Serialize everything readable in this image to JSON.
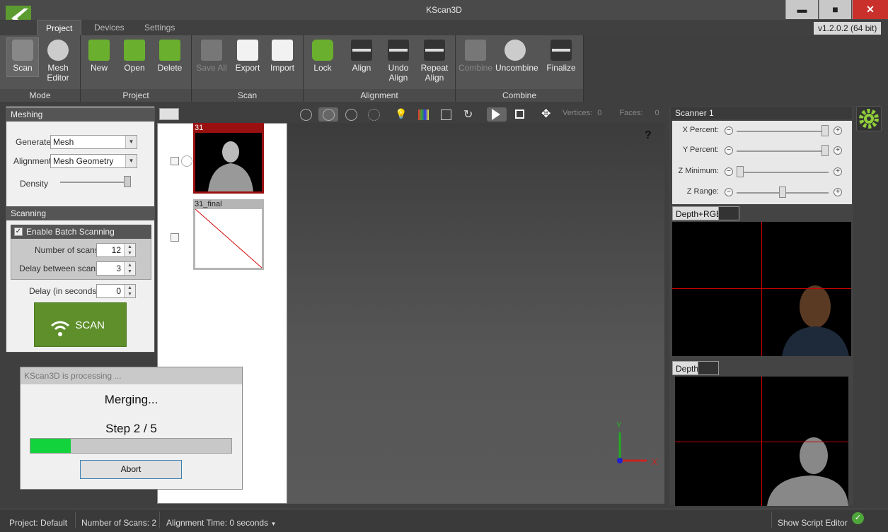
{
  "app": {
    "title": "KScan3D",
    "version": "v1.2.0.2  (64 bit)"
  },
  "window": {
    "minimize": "▬",
    "maximize": "■",
    "close": "✕"
  },
  "tabs": [
    "Project",
    "Devices",
    "Settings"
  ],
  "ribbon": {
    "mode": {
      "label": "Mode",
      "scan": "Scan",
      "mesh_editor": "Mesh Editor"
    },
    "project": {
      "label": "Project",
      "new": "New",
      "open": "Open",
      "delete": "Delete"
    },
    "scan": {
      "label": "Scan",
      "save_all": "Save All",
      "export": "Export",
      "import": "Import"
    },
    "alignment": {
      "label": "Alignment",
      "lock": "Lock",
      "align": "Align",
      "undo_align": "Undo Align",
      "repeat_align": "Repeat Align"
    },
    "combine": {
      "label": "Combine",
      "combine": "Combine",
      "uncombine": "Uncombine",
      "finalize": "Finalize"
    }
  },
  "meshing": {
    "title": "Meshing",
    "generate_label": "Generate",
    "generate_value": "Mesh",
    "alignment_label": "Alignment",
    "alignment_value": "Mesh Geometry",
    "density_label": "Density",
    "density_level": 0.95
  },
  "scanning": {
    "title": "Scanning",
    "batch_label": "Enable Batch Scanning",
    "batch_enabled": true,
    "num_scans_label": "Number of scans",
    "num_scans": "12",
    "delay_between_label": "Delay between scans",
    "delay_between": "3",
    "delay_seconds_label": "Delay (in seconds)",
    "delay_seconds": "0",
    "scan_button": "SCAN"
  },
  "scans": [
    {
      "name": "31",
      "selected": true
    },
    {
      "name": "31_final",
      "selected": false
    }
  ],
  "viewport": {
    "vertices_label": "Vertices:",
    "vertices": "0",
    "faces_label": "Faces:",
    "faces": "0",
    "help": "?",
    "axis_x": "X",
    "axis_y": "Y"
  },
  "scanner": {
    "title": "Scanner 1",
    "sliders": [
      {
        "label": "X Percent:",
        "value": 0.96
      },
      {
        "label": "Y Percent:",
        "value": 0.96
      },
      {
        "label": "Z Minimum:",
        "value": 0.04
      },
      {
        "label": "Z Range:",
        "value": 0.5
      }
    ],
    "feed1_tab": "Depth+RGB",
    "feed2_tab": "Depth"
  },
  "dialog": {
    "title": "KScan3D is processing ...",
    "message": "Merging...",
    "step": "Step 2 / 5",
    "progress": 0.2,
    "abort": "Abort"
  },
  "status": {
    "project_label": "Project:",
    "project": "Default",
    "num_scans_label": "Number of Scans:",
    "num_scans": "2",
    "align_time_label": "Alignment Time:",
    "align_time": "0 seconds",
    "script_editor": "Show Script Editor"
  }
}
